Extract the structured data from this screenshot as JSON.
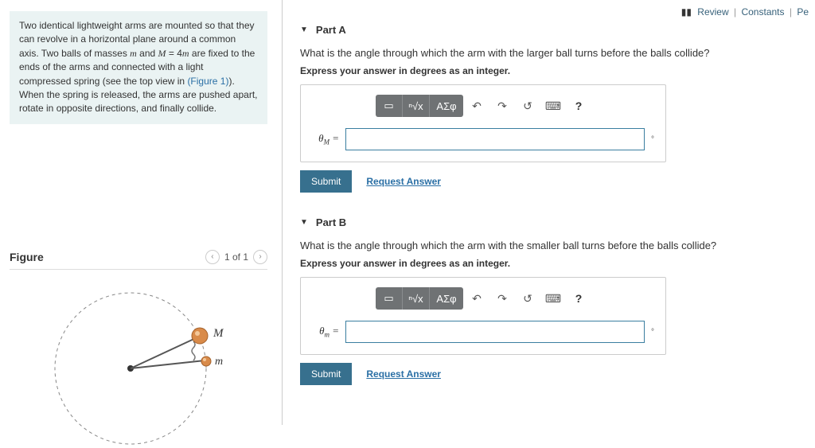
{
  "topLinks": {
    "review": "Review",
    "constants": "Constants",
    "periodic": "Pe"
  },
  "problem": {
    "text_pre": "Two identical lightweight arms are mounted so that they can revolve in a horizontal plane around a common axis. Two balls of masses ",
    "m": "m",
    "and": " and ",
    "M": "M",
    "eq": " = 4",
    "m2": "m",
    "text_mid": " are fixed to the ends of the arms and connected with a light compressed spring (see the top view in ",
    "figlink": "(Figure 1)",
    "text_post": "). When the spring is released, the arms are pushed apart, rotate in opposite directions, and finally collide."
  },
  "figure": {
    "title": "Figure",
    "pager": "1 of 1",
    "labelM": "M",
    "labelm": "m"
  },
  "partA": {
    "label": "Part A",
    "question": "What is the angle through which the arm with the larger ball turns before the balls collide?",
    "instruct": "Express your answer in degrees as an integer.",
    "var_html": "θ<sub>M</sub> =",
    "submit": "Submit",
    "request": "Request Answer"
  },
  "partB": {
    "label": "Part B",
    "question": "What is the angle through which the arm with the smaller ball turns before the balls collide?",
    "instruct": "Express your answer in degrees as an integer.",
    "var_html": "θ<sub>m</sub> =",
    "submit": "Submit",
    "request": "Request Answer"
  },
  "toolbar": {
    "templates": "▭",
    "xroot": "ⁿ√x",
    "greek": "ΑΣφ",
    "undo": "↶",
    "redo": "↷",
    "reset": "↺",
    "keyboard": "⌨",
    "help": "?"
  }
}
